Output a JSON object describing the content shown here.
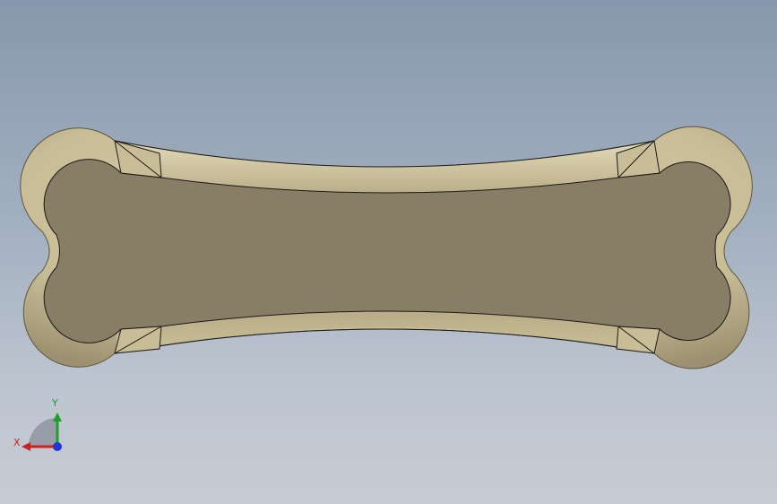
{
  "viewport": {
    "model": "bone-shaped-part"
  },
  "triad": {
    "x_label": "X",
    "y_label": "Y",
    "colors": {
      "x_axis": "#d0201c",
      "y_axis": "#1ea027",
      "z_axis": "#2137d6"
    }
  },
  "colors": {
    "background_top": "#8798ad",
    "background_bottom": "#c6ccd5",
    "model_rim": "#c8bd96",
    "model_face": "#887d65",
    "model_edge": "#1a1a1a"
  }
}
